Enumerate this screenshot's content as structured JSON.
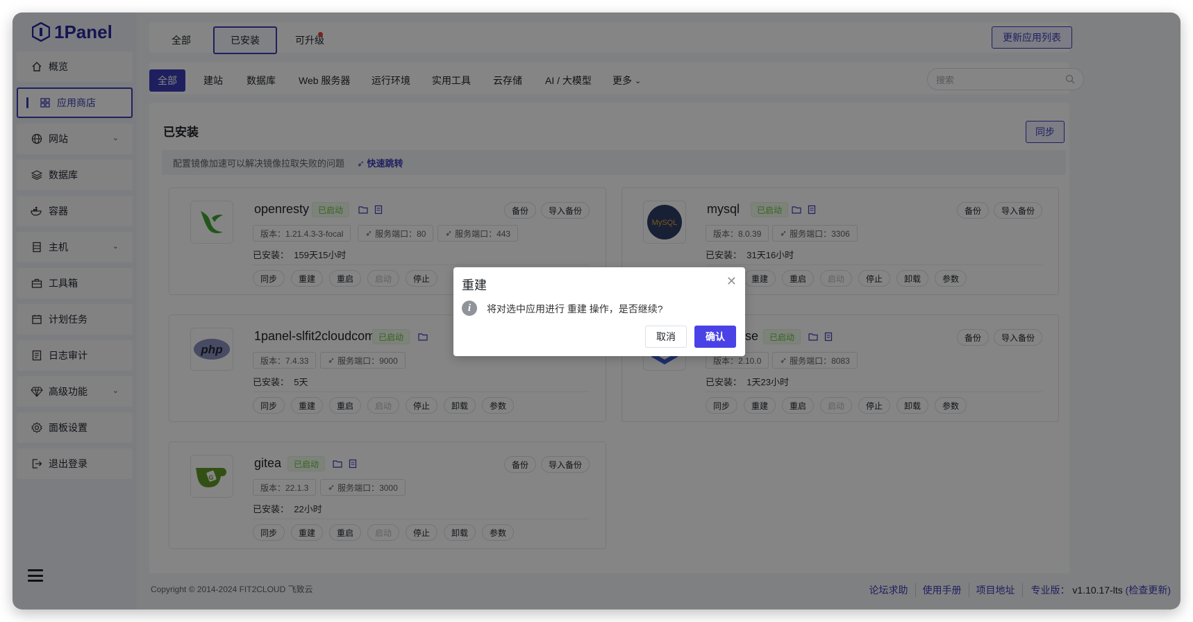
{
  "brand": {
    "name": "1Panel"
  },
  "sidebar": {
    "items": [
      {
        "label": "概览",
        "icon": "home-icon"
      },
      {
        "label": "应用商店",
        "icon": "grid-icon",
        "active": true
      },
      {
        "label": "网站",
        "icon": "globe-icon",
        "expandable": true
      },
      {
        "label": "数据库",
        "icon": "layers-icon"
      },
      {
        "label": "容器",
        "icon": "docker-icon"
      },
      {
        "label": "主机",
        "icon": "server-icon",
        "expandable": true
      },
      {
        "label": "工具箱",
        "icon": "toolbox-icon"
      },
      {
        "label": "计划任务",
        "icon": "calendar-icon"
      },
      {
        "label": "日志审计",
        "icon": "log-icon"
      },
      {
        "label": "高级功能",
        "icon": "diamond-icon",
        "expandable": true
      },
      {
        "label": "面板设置",
        "icon": "gear-icon"
      },
      {
        "label": "退出登录",
        "icon": "logout-icon"
      }
    ]
  },
  "tabs": {
    "all": "全部",
    "installed": "已安装",
    "upgradable": "可升级"
  },
  "update_button": "更新应用列表",
  "categories": [
    "全部",
    "建站",
    "数据库",
    "Web 服务器",
    "运行环境",
    "实用工具",
    "云存储",
    "AI / 大模型",
    "更多"
  ],
  "search": {
    "placeholder": "搜索"
  },
  "panel": {
    "title": "已安装",
    "sync_button": "同步",
    "notice": "配置镜像加速可以解决镜像拉取失败的问题",
    "notice_link": "快速跳转"
  },
  "labels": {
    "running": "已启动",
    "backup": "备份",
    "import_backup": "导入备份",
    "installed_prefix": "已安装："
  },
  "actions": [
    "同步",
    "重建",
    "重启",
    "启动",
    "停止",
    "卸载",
    "参数"
  ],
  "apps": [
    {
      "name": "openresty",
      "version": "版本：1.21.4.3-3-focal",
      "ports": [
        "服务端口：80",
        "服务端口：443"
      ],
      "installed": "159天15小时"
    },
    {
      "name": "mysql",
      "version": "版本：8.0.39",
      "ports": [
        "服务端口：3306"
      ],
      "installed": "31天16小时"
    },
    {
      "name": "1panel-slfit2cloudcom",
      "version": "版本：7.4.33",
      "ports": [
        "服务端口：9000"
      ],
      "installed": "5天"
    },
    {
      "name": "dataease",
      "version": "版本：2.10.0",
      "ports": [
        "服务端口：8083"
      ],
      "installed": "1天23小时"
    },
    {
      "name": "gitea",
      "version": "版本：22.1.3",
      "ports": [
        "服务端口：3000"
      ],
      "installed": "22小时"
    }
  ],
  "footer": {
    "copyright": "Copyright © 2014-2024 FIT2CLOUD 飞致云",
    "links": [
      "论坛求助",
      "使用手册",
      "项目地址"
    ],
    "edition_label": "专业版：",
    "version": "v1.10.17-lts",
    "check_update": "(检查更新)"
  },
  "dialog": {
    "title": "重建",
    "message": "将对选中应用进行 重建 操作，是否继续?",
    "cancel": "取消",
    "confirm": "确认"
  },
  "colors": {
    "accent": "#3d3db8",
    "confirm": "#4a42e6",
    "running": "#67c23a"
  }
}
